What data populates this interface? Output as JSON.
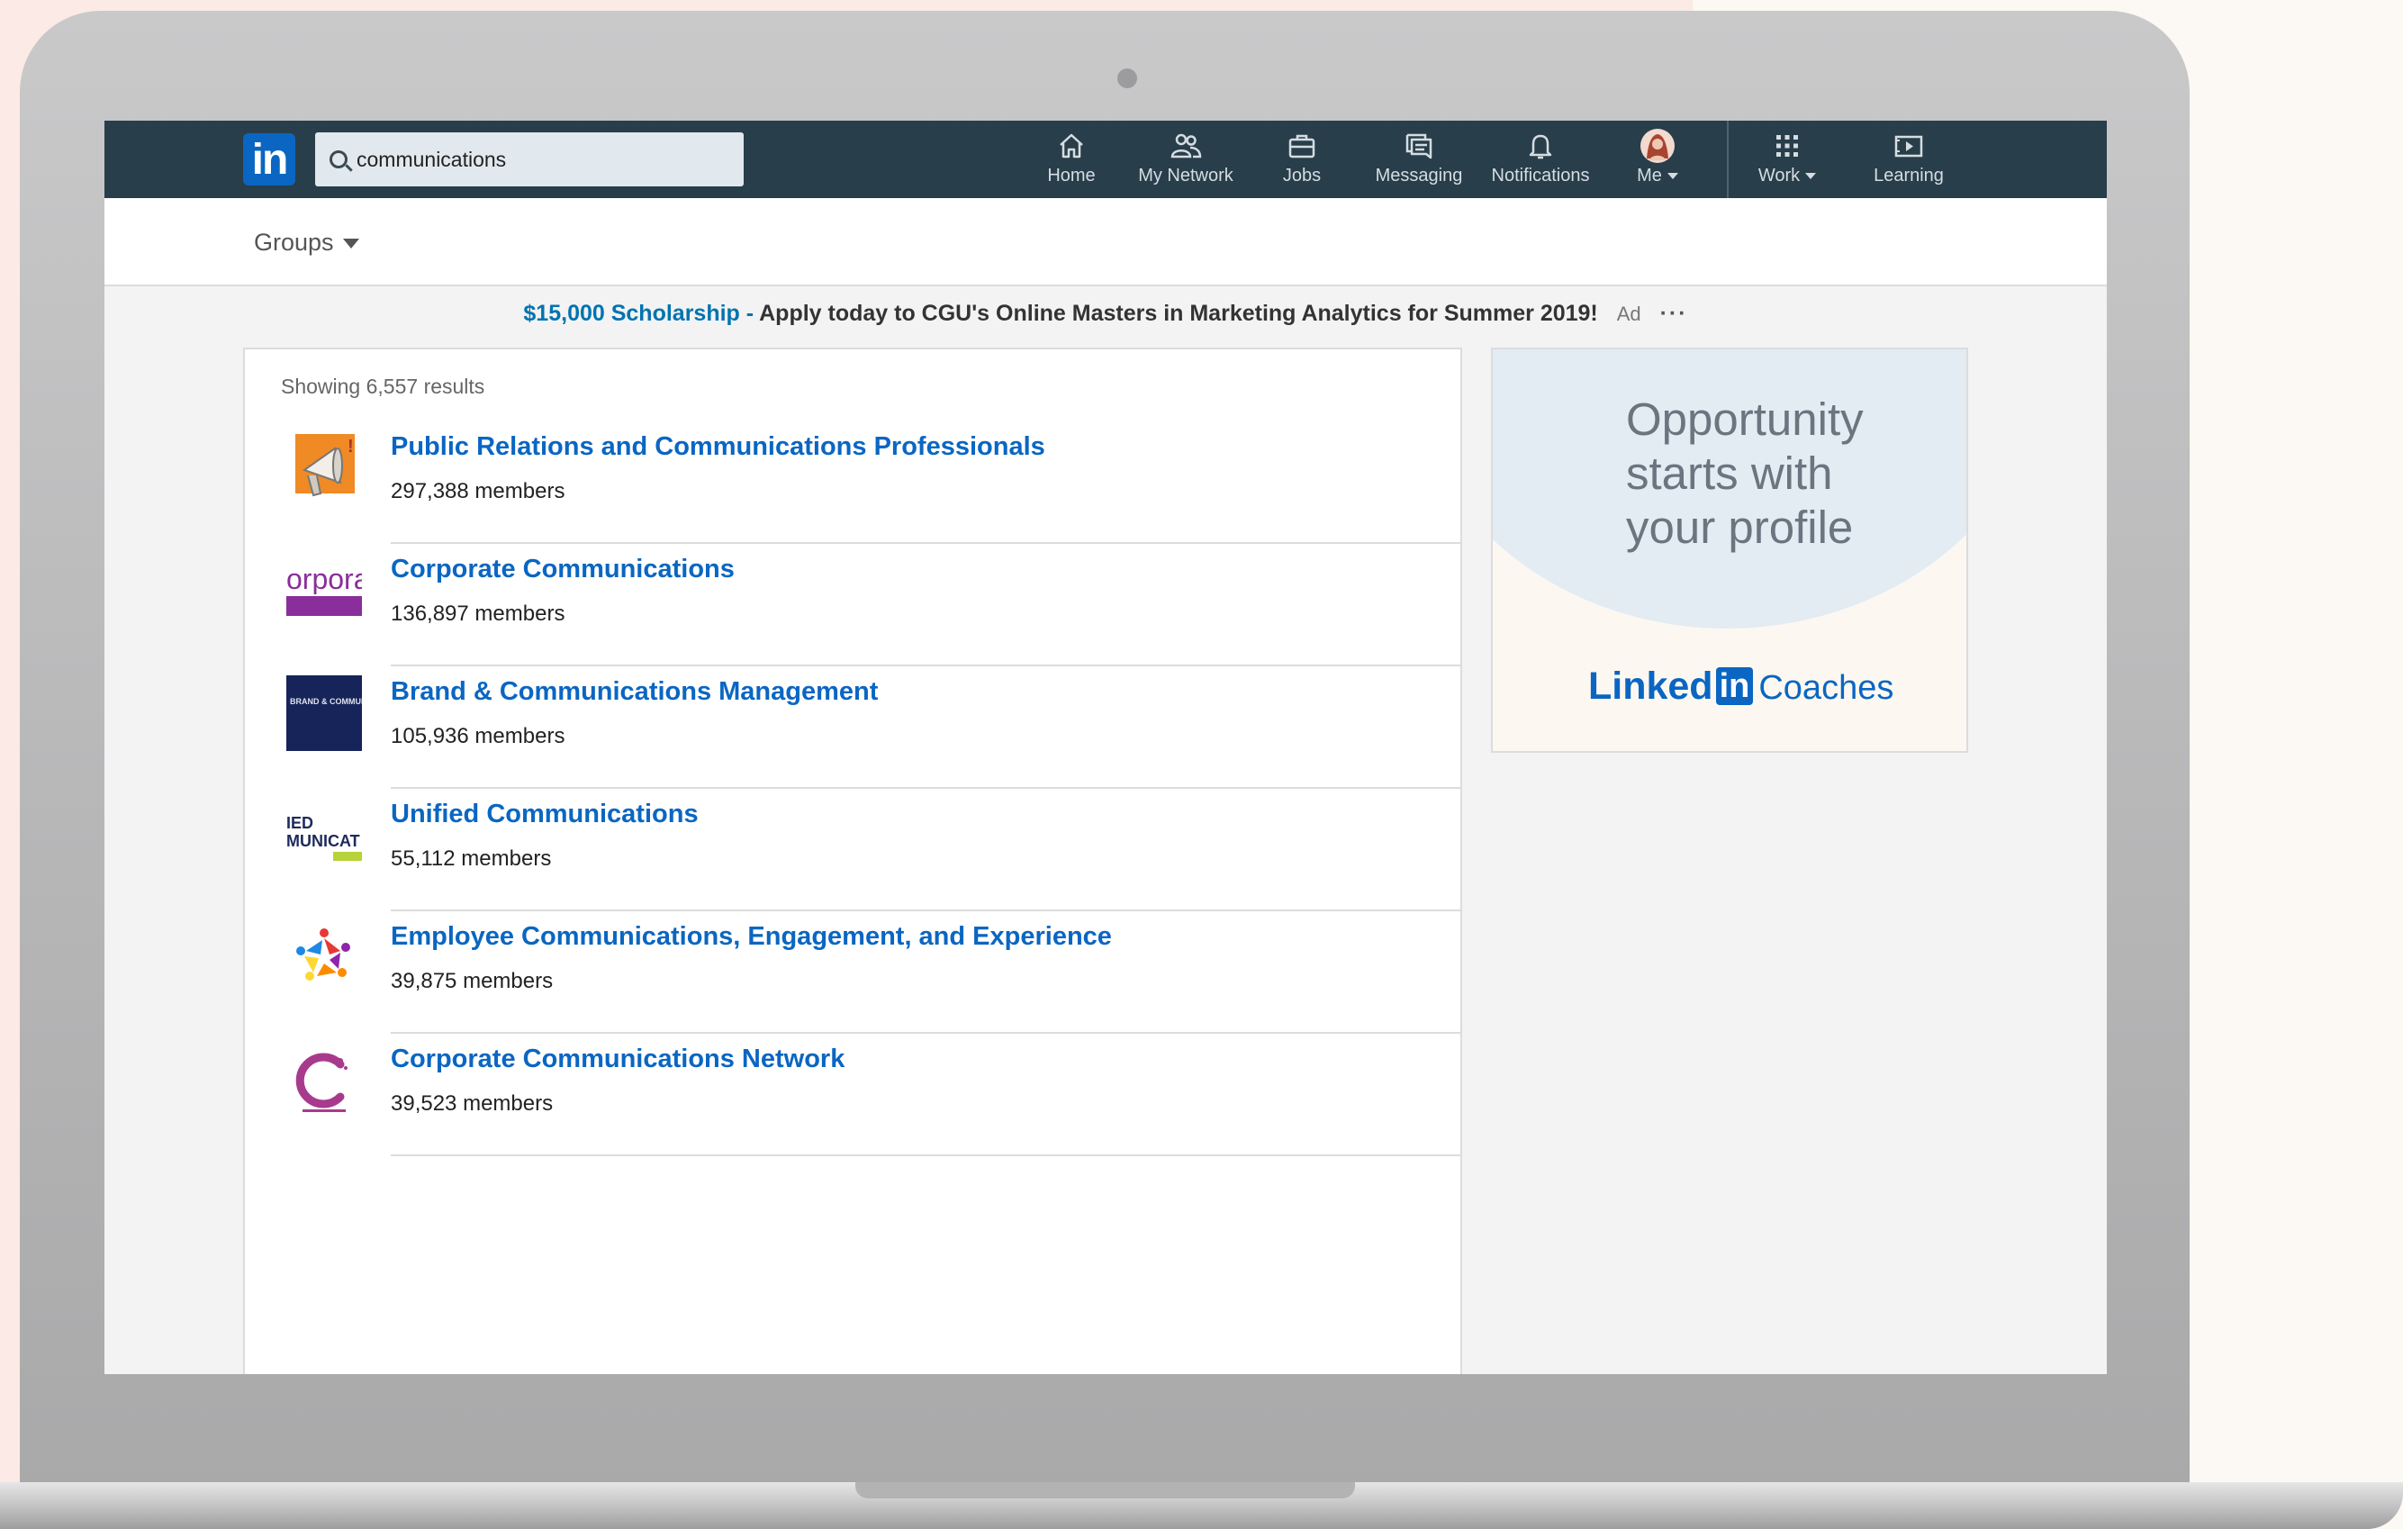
{
  "search": {
    "value": "communications"
  },
  "nav": {
    "items": [
      {
        "label": "Home"
      },
      {
        "label": "My Network"
      },
      {
        "label": "Jobs"
      },
      {
        "label": "Messaging"
      },
      {
        "label": "Notifications"
      },
      {
        "label": "Me"
      },
      {
        "label": "Work"
      },
      {
        "label": "Learning"
      }
    ]
  },
  "filter": {
    "label": "Groups"
  },
  "ad_line": {
    "link_text": "$15,000 Scholarship -",
    "text": "Apply today to CGU's Online Masters in Marketing Analytics for Summer 2019!",
    "tag": "Ad",
    "more": "···"
  },
  "results": {
    "count_text": "Showing 6,557 results",
    "items": [
      {
        "title": "Public Relations and Communications Professionals",
        "members": "297,388 members",
        "thumb_text": ""
      },
      {
        "title": "Corporate Communications",
        "members": "136,897 members",
        "thumb_text": "orpora"
      },
      {
        "title": "Brand & Communications Management",
        "members": "105,936 members",
        "thumb_text": "BRAND & COMMUNICA"
      },
      {
        "title": "Unified Communications",
        "members": "55,112 members",
        "thumb_text": "IED MUNICAT"
      },
      {
        "title": "Employee Communications, Engagement, and Experience",
        "members": "39,875 members",
        "thumb_text": ""
      },
      {
        "title": "Corporate Communications Network",
        "members": "39,523 members",
        "thumb_text": ""
      }
    ]
  },
  "side_ad": {
    "line1": "Opportunity",
    "line2": "starts with",
    "line3": "your profile",
    "brand_linked": "Linked",
    "brand_in": "in",
    "brand_product": "Coaches"
  }
}
